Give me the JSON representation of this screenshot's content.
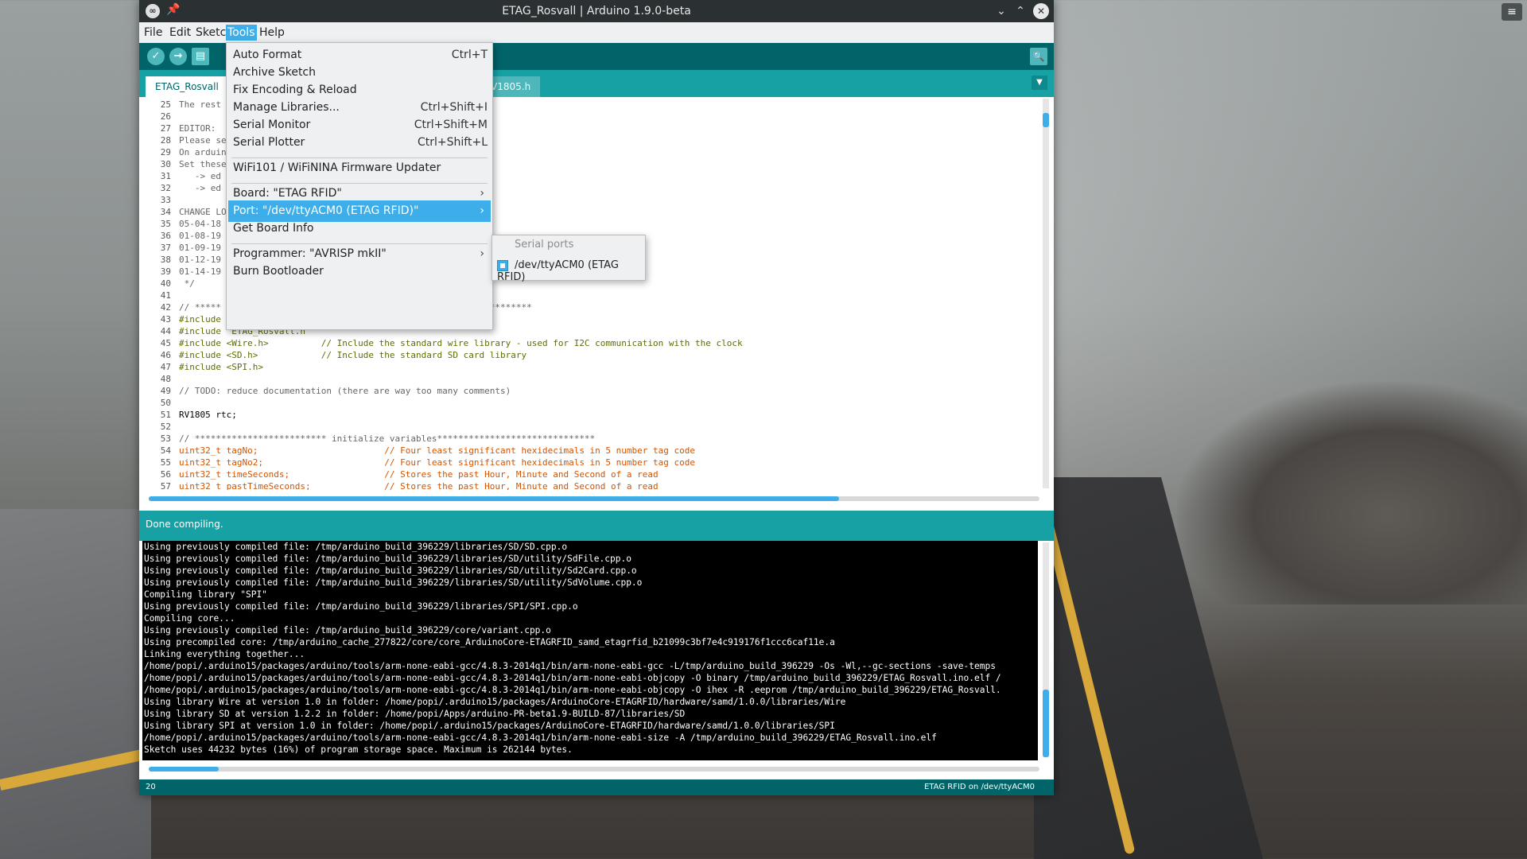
{
  "window": {
    "title": "ETAG_Rosvall | Arduino 1.9.0-beta"
  },
  "menubar": [
    "File",
    "Edit",
    "Sketch",
    "Tools",
    "Help"
  ],
  "tabs": [
    "ETAG_Rosvall",
    "V1805.h"
  ],
  "tools_menu": {
    "items": [
      {
        "label": "Auto Format",
        "shortcut": "Ctrl+T"
      },
      {
        "label": "Archive Sketch",
        "shortcut": ""
      },
      {
        "label": "Fix Encoding & Reload",
        "shortcut": ""
      },
      {
        "label": "Manage Libraries...",
        "shortcut": "Ctrl+Shift+I"
      },
      {
        "label": "Serial Monitor",
        "shortcut": "Ctrl+Shift+M"
      },
      {
        "label": "Serial Plotter",
        "shortcut": "Ctrl+Shift+L"
      },
      {
        "label": "WiFi101 / WiFiNINA Firmware Updater",
        "shortcut": ""
      },
      {
        "label": "Board: \"ETAG RFID\"",
        "shortcut": ""
      },
      {
        "label": "Port: \"/dev/ttyACM0 (ETAG RFID)\"",
        "shortcut": ""
      },
      {
        "label": "Get Board Info",
        "shortcut": ""
      },
      {
        "label": "Programmer: \"AVRISP mkII\"",
        "shortcut": ""
      },
      {
        "label": "Burn Bootloader",
        "shortcut": ""
      }
    ]
  },
  "port_submenu": {
    "header": "Serial ports",
    "item": "/dev/ttyACM0 (ETAG RFID)"
  },
  "editor_lines": [
    {
      "n": "25",
      "t": "The rest"
    },
    {
      "n": "26",
      "t": ""
    },
    {
      "n": "27",
      "t": "EDITOR:"
    },
    {
      "n": "28",
      "t": "Please se"
    },
    {
      "n": "29",
      "t": "On arduin                                          es.txt"
    },
    {
      "n": "30",
      "t": "Set these"
    },
    {
      "n": "31",
      "t": "   -> ed"
    },
    {
      "n": "32",
      "t": "   -> ed"
    },
    {
      "n": "33",
      "t": ""
    },
    {
      "n": "34",
      "t": "CHANGE LO"
    },
    {
      "n": "35",
      "t": "05-04-18                                           )"
    },
    {
      "n": "36",
      "t": "01-08-19"
    },
    {
      "n": "37",
      "t": "01-09-19"
    },
    {
      "n": "38",
      "t": "01-12-19"
    },
    {
      "n": "39",
      "t": "01-14-19                                              2 (dmitriigalantsev)"
    },
    {
      "n": "40",
      "t": " */"
    },
    {
      "n": "41",
      "t": ""
    },
    {
      "n": "42",
      "t": "// *****                                              *************"
    },
    {
      "n": "43",
      "t": "#include"
    },
    {
      "n": "44",
      "t": "#include \"ETAG_Rosvall.h\""
    },
    {
      "n": "45",
      "t": "#include <Wire.h>          // Include the standard wire library - used for I2C communication with the clock"
    },
    {
      "n": "46",
      "t": "#include <SD.h>            // Include the standard SD card library"
    },
    {
      "n": "47",
      "t": "#include <SPI.h>"
    },
    {
      "n": "48",
      "t": ""
    },
    {
      "n": "49",
      "t": "// TODO: reduce documentation (there are way too many comments)"
    },
    {
      "n": "50",
      "t": ""
    },
    {
      "n": "51",
      "t": "RV1805 rtc;"
    },
    {
      "n": "52",
      "t": ""
    },
    {
      "n": "53",
      "t": "// ************************* initialize variables******************************"
    },
    {
      "n": "54",
      "t": "uint32_t tagNo;                        // Four least significant hexidecimals in 5 number tag code"
    },
    {
      "n": "55",
      "t": "uint32_t tagNo2;                       // Four least significant hexidecimals in 5 number tag code"
    },
    {
      "n": "56",
      "t": "uint32_t timeSeconds;                  // Stores the past Hour, Minute and Second of a read"
    },
    {
      "n": "57",
      "t": "uint32_t pastTimeSeconds;              // Stores the past Hour, Minute and Second of a read"
    }
  ],
  "status_message": "Done compiling.",
  "console_lines": [
    "Using previously compiled file: /tmp/arduino_build_396229/libraries/SD/SD.cpp.o",
    "Using previously compiled file: /tmp/arduino_build_396229/libraries/SD/utility/SdFile.cpp.o",
    "Using previously compiled file: /tmp/arduino_build_396229/libraries/SD/utility/Sd2Card.cpp.o",
    "Using previously compiled file: /tmp/arduino_build_396229/libraries/SD/utility/SdVolume.cpp.o",
    "Compiling library \"SPI\"",
    "Using previously compiled file: /tmp/arduino_build_396229/libraries/SPI/SPI.cpp.o",
    "Compiling core...",
    "Using previously compiled file: /tmp/arduino_build_396229/core/variant.cpp.o",
    "Using precompiled core: /tmp/arduino_cache_277822/core/core_ArduinoCore-ETAGRFID_samd_etagrfid_b21099c3bf7e4c919176f1ccc6caf11e.a",
    "Linking everything together...",
    "/home/popi/.arduino15/packages/arduino/tools/arm-none-eabi-gcc/4.8.3-2014q1/bin/arm-none-eabi-gcc -L/tmp/arduino_build_396229 -Os -Wl,--gc-sections -save-temps",
    "/home/popi/.arduino15/packages/arduino/tools/arm-none-eabi-gcc/4.8.3-2014q1/bin/arm-none-eabi-objcopy -O binary /tmp/arduino_build_396229/ETAG_Rosvall.ino.elf /",
    "/home/popi/.arduino15/packages/arduino/tools/arm-none-eabi-gcc/4.8.3-2014q1/bin/arm-none-eabi-objcopy -O ihex -R .eeprom /tmp/arduino_build_396229/ETAG_Rosvall.",
    "Using library Wire at version 1.0 in folder: /home/popi/.arduino15/packages/ArduinoCore-ETAGRFID/hardware/samd/1.0.0/libraries/Wire",
    "Using library SD at version 1.2.2 in folder: /home/popi/Apps/arduino-PR-beta1.9-BUILD-87/libraries/SD",
    "Using library SPI at version 1.0 in folder: /home/popi/.arduino15/packages/ArduinoCore-ETAGRFID/hardware/samd/1.0.0/libraries/SPI",
    "/home/popi/.arduino15/packages/arduino/tools/arm-none-eabi-gcc/4.8.3-2014q1/bin/arm-none-eabi-size -A /tmp/arduino_build_396229/ETAG_Rosvall.ino.elf",
    "Sketch uses 44232 bytes (16%) of program storage space. Maximum is 262144 bytes."
  ],
  "footer": {
    "line": "20",
    "board": "ETAG RFID on /dev/ttyACM0"
  },
  "colors": {
    "teal_dark": "#006468",
    "teal": "#17a1a5",
    "highlight": "#3daee9"
  }
}
